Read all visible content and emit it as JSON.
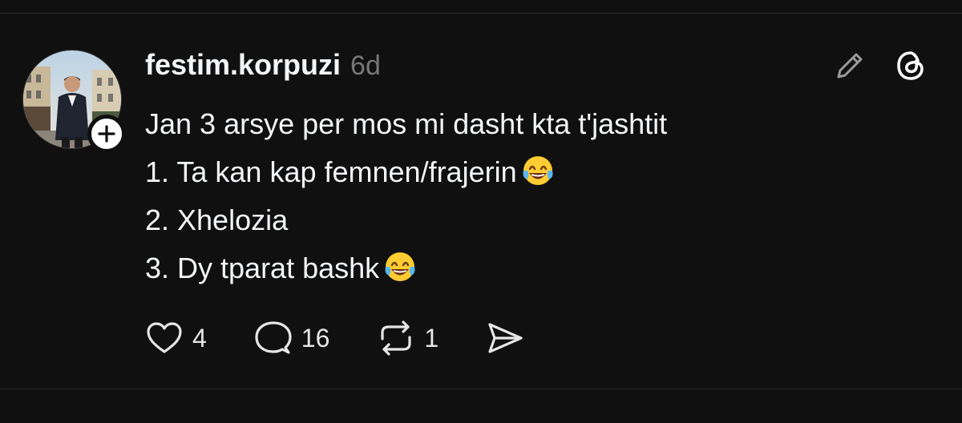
{
  "post": {
    "username": "festim.korpuzi",
    "timestamp": "6d",
    "lines": [
      "Jan 3 arsye per mos mi dasht kta t'jashtit",
      "1. Ta kan kap femnen/frajerin",
      "2. Xhelozia",
      "3. Dy tparat bashk"
    ],
    "line_emojis": [
      "",
      "face-with-tears-of-joy",
      "",
      "face-with-tears-of-joy"
    ],
    "actions": {
      "likes": "4",
      "replies": "16",
      "reposts": "1"
    }
  },
  "icons": {
    "edit": "pencil-icon",
    "app": "threads-logo-icon",
    "like": "heart-icon",
    "reply": "comment-icon",
    "repost": "repost-icon",
    "share": "send-icon",
    "follow": "plus-icon"
  },
  "colors": {
    "background": "#101010",
    "text": "#f3f5f7",
    "muted": "#777777",
    "divider": "#2a2a2a"
  }
}
